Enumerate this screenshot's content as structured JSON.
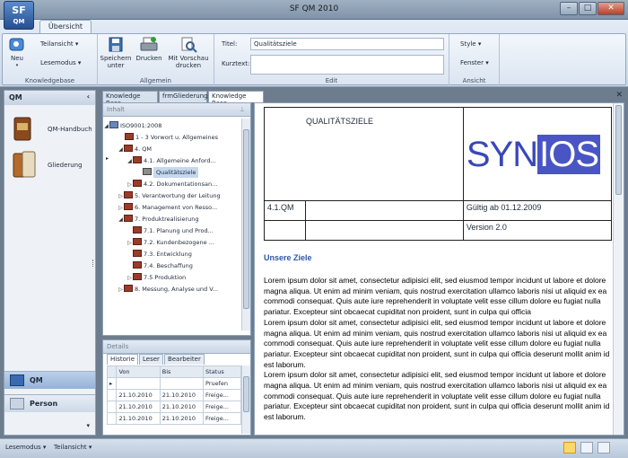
{
  "app": {
    "title": "SF QM 2010",
    "logo_top": "SF",
    "logo_bottom": "QM"
  },
  "window": {
    "minimize": "–",
    "maximize": "□",
    "close": "✕"
  },
  "ribbon": {
    "tab": "Übersicht",
    "groups": {
      "knowledgebase": {
        "label": "Knowledgebase",
        "neu": "Neu",
        "teilansicht": "Teilansicht",
        "lesemodus": "Lesemodus"
      },
      "allgemein": {
        "label": "Allgemein",
        "speichern": "Speichern unter",
        "drucken": "Drucken",
        "vorschau": "Mit Vorschau drucken"
      },
      "edit": {
        "label": "Edit",
        "titel_label": "Titel:",
        "titel_value": "Qualitätsziele",
        "kurztext_label": "Kurztext:",
        "kurztext_value": ""
      },
      "ansicht": {
        "label": "Ansicht",
        "style": "Style",
        "fenster": "Fenster"
      }
    }
  },
  "nav": {
    "header": "QM",
    "items": [
      "QM-Handbuch",
      "Gliederung"
    ],
    "bottom": [
      "QM",
      "Person"
    ]
  },
  "doc_tabs": [
    "Knowledge Base",
    "frmGliederung",
    "Knowledge Base"
  ],
  "tree_panel": {
    "header": "Inhalt",
    "rows": [
      "ISO9001:2008",
      "1 - 3 Vorwort u. Allgemeines",
      "4. QM",
      "4.1. Allgemeine Anford...",
      "Qualitätsziele",
      "4.2. Dokumentationsan...",
      "5. Verantwortung der Leitung",
      "6. Management von Resso...",
      "7. Produktrealisierung",
      "7.1. Planung und Prod...",
      "7.2. Kundenbezogene ...",
      "7.3. Entwicklung",
      "7.4. Beschaffung",
      "7.5 Produktion",
      "8. Messung, Analyse und V..."
    ]
  },
  "details": {
    "header": "Details",
    "tabs": [
      "Historie",
      "Leser",
      "Bearbeiter"
    ],
    "columns": [
      "Von",
      "Bis",
      "Status"
    ],
    "rows": [
      [
        "",
        "",
        "Pruefen"
      ],
      [
        "21.10.2010",
        "21.10.2010",
        "Freige..."
      ],
      [
        "21.10.2010",
        "21.10.2010",
        "Freige..."
      ],
      [
        "21.10.2010",
        "21.10.2010",
        "Freige..."
      ]
    ]
  },
  "document": {
    "header_title": "QUALITÄTSZIELE",
    "logo_a": "SYN",
    "logo_b": "IOS",
    "number": "4.1.QM",
    "valid": "Gültig ab 01.12.2009",
    "version": "Version 2.0",
    "section": "Unsere Ziele",
    "para1": "Lorem ipsum dolor sit amet, consectetur adipisici elit, sed eiusmod tempor incidunt ut labore et dolore magna aliqua. Ut enim ad minim veniam, quis nostrud exercitation ullamco laboris nisi ut aliquid ex ea commodi consequat. Quis aute iure reprehenderit in voluptate velit esse cillum dolore eu fugiat nulla pariatur. Excepteur sint obcaecat cupiditat non proident, sunt in culpa qui officia",
    "para2": "Lorem ipsum dolor sit amet, consectetur adipisici elit, sed eiusmod tempor incidunt ut labore et dolore magna aliqua. Ut enim ad minim veniam, quis nostrud exercitation ullamco laboris nisi ut aliquid ex ea commodi consequat. Quis aute iure reprehenderit in voluptate velit esse cillum dolore eu fugiat nulla pariatur. Excepteur sint obcaecat cupiditat non proident, sunt in culpa qui officia deserunt mollit anim id est laborum.",
    "para3": "Lorem ipsum dolor sit amet, consectetur adipisici elit, sed eiusmod tempor incidunt ut labore et dolore magna aliqua. Ut enim ad minim veniam, quis nostrud exercitation ullamco laboris nisi ut aliquid ex ea commodi consequat. Quis aute iure reprehenderit in voluptate velit esse cillum dolore eu fugiat nulla pariatur. Excepteur sint obcaecat cupiditat non proident, sunt in culpa qui officia deserunt mollit anim id est laborum."
  },
  "statusbar": {
    "lesemodus": "Lesemodus",
    "teilansicht": "Teilansicht"
  },
  "colors": {
    "accent": "#3a47b8",
    "section": "#2e57a6",
    "selection": "#c5d8f0"
  }
}
